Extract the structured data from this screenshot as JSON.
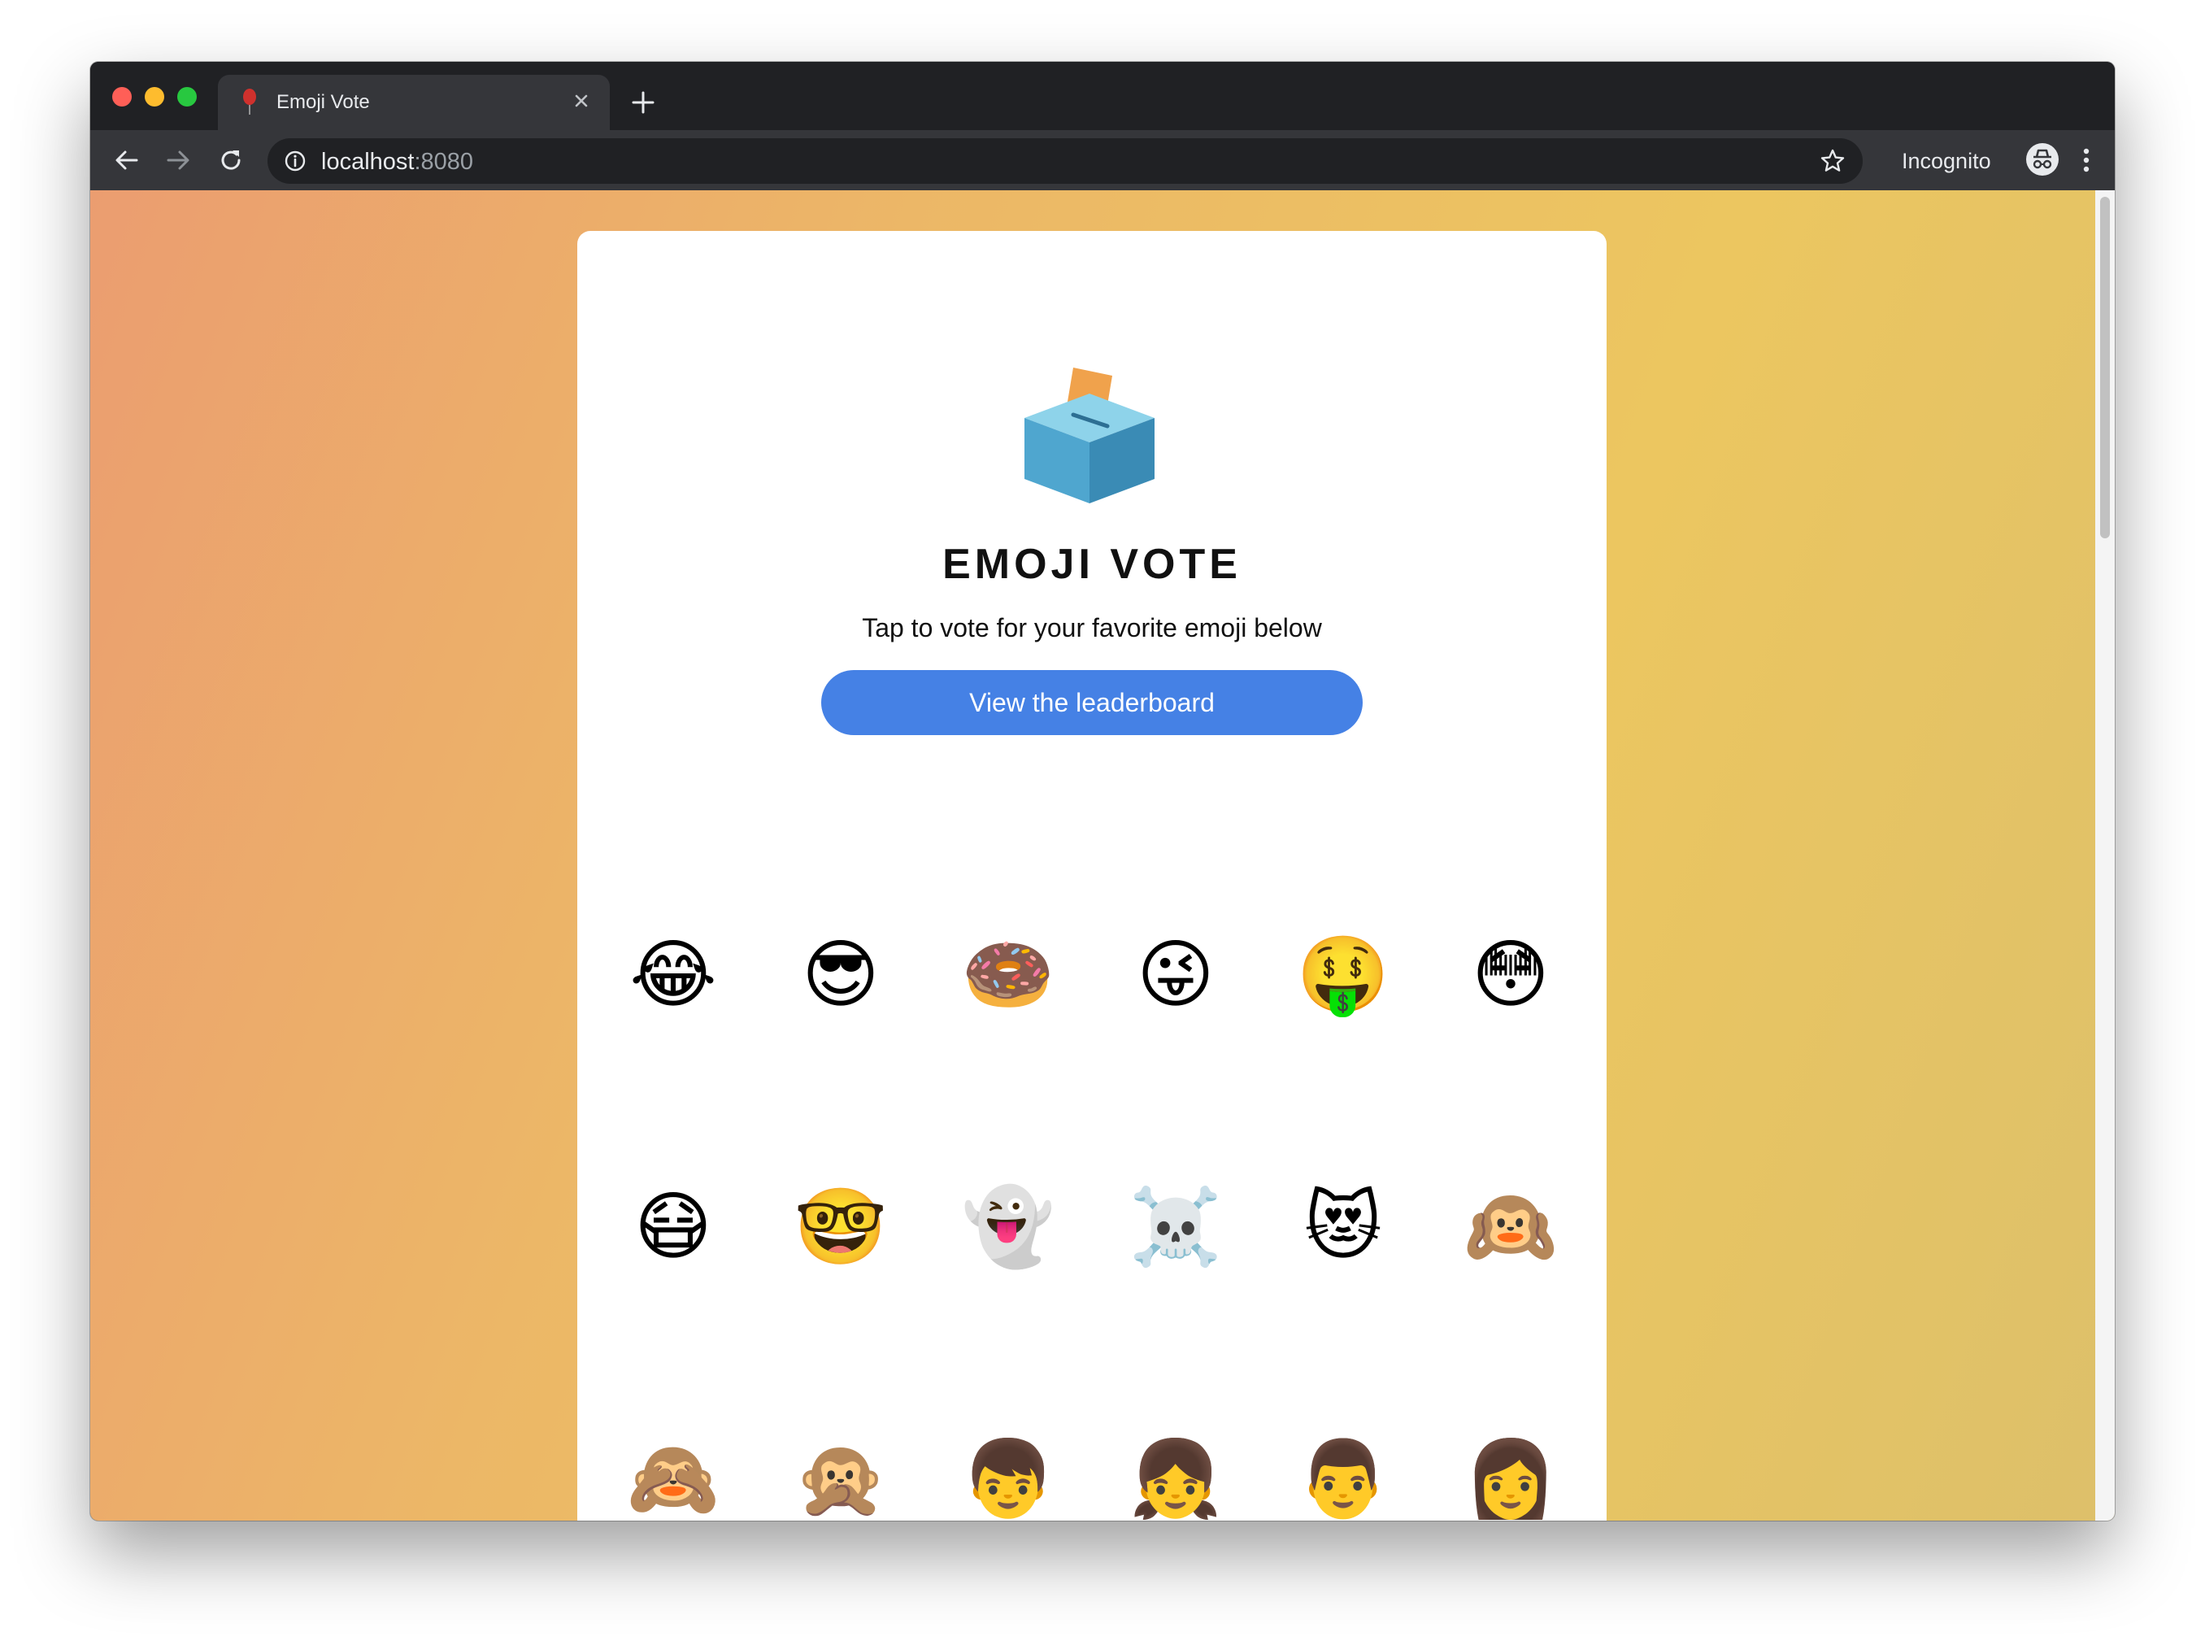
{
  "browser": {
    "tab_title": "Emoji Vote",
    "url_host": "localhost",
    "url_port": ":8080",
    "profile_label": "Incognito"
  },
  "page": {
    "title": "EMOJI VOTE",
    "subtitle": "Tap to vote for your favorite emoji below",
    "leaderboard_button": "View the leaderboard"
  },
  "emojis": [
    "😂",
    "😎",
    "🍩",
    "😜",
    "🤑",
    "😳",
    "😷",
    "🤓",
    "👻",
    "☠️",
    "😻",
    "🙉",
    "🙈",
    "🙊",
    "👦",
    "👧",
    "👨",
    "👩"
  ],
  "colors": {
    "accent": "#4581e5",
    "gradient_start": "#eb9d70",
    "gradient_end": "#ddc06a",
    "chrome_dark": "#202124",
    "chrome_toolbar": "#35363a"
  }
}
